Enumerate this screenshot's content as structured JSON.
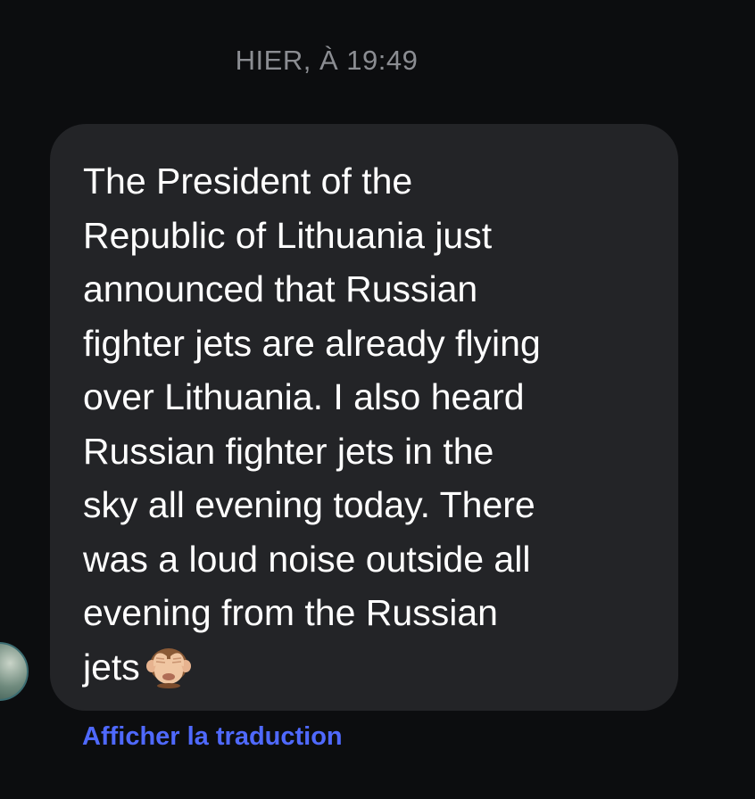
{
  "timestamp": "HIER, À 19:49",
  "message": {
    "text": "The President of the\nRepublic of Lithuania just\nannounced that Russian\nfighter jets are already flying\nover Lithuania. I also heard\nRussian fighter jets in the\nsky all evening today. There\nwas a loud noise outside all\nevening from the Russian\njets",
    "emoji": "see-no-evil-monkey-icon"
  },
  "actions": {
    "translate_label": "Afficher la traduction"
  },
  "colors": {
    "background": "#0c0d0f",
    "bubble": "#232427",
    "timestamp": "#8b8d92",
    "link": "#4f69ff"
  }
}
